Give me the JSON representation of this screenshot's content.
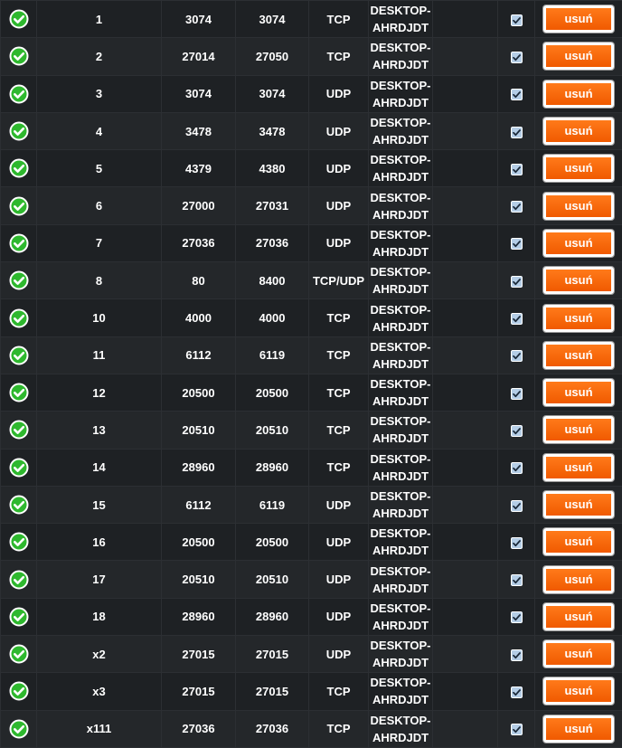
{
  "icons": {
    "status": "check-circle-icon",
    "enabled": "checkbox-checked-icon"
  },
  "colors": {
    "status_ok": "#2eb82e",
    "delete_button": "#f26a00",
    "checkbox": "#b4cde6"
  },
  "delete_label": "usuń",
  "rules": [
    {
      "id": "1",
      "ext_port": "3074",
      "int_port": "3074",
      "protocol": "TCP",
      "host_line1": "DESKTOP-",
      "host_line2": "AHRDJDT",
      "enabled": true
    },
    {
      "id": "2",
      "ext_port": "27014",
      "int_port": "27050",
      "protocol": "TCP",
      "host_line1": "DESKTOP-",
      "host_line2": "AHRDJDT",
      "enabled": true
    },
    {
      "id": "3",
      "ext_port": "3074",
      "int_port": "3074",
      "protocol": "UDP",
      "host_line1": "DESKTOP-",
      "host_line2": "AHRDJDT",
      "enabled": true
    },
    {
      "id": "4",
      "ext_port": "3478",
      "int_port": "3478",
      "protocol": "UDP",
      "host_line1": "DESKTOP-",
      "host_line2": "AHRDJDT",
      "enabled": true
    },
    {
      "id": "5",
      "ext_port": "4379",
      "int_port": "4380",
      "protocol": "UDP",
      "host_line1": "DESKTOP-",
      "host_line2": "AHRDJDT",
      "enabled": true
    },
    {
      "id": "6",
      "ext_port": "27000",
      "int_port": "27031",
      "protocol": "UDP",
      "host_line1": "DESKTOP-",
      "host_line2": "AHRDJDT",
      "enabled": true
    },
    {
      "id": "7",
      "ext_port": "27036",
      "int_port": "27036",
      "protocol": "UDP",
      "host_line1": "DESKTOP-",
      "host_line2": "AHRDJDT",
      "enabled": true
    },
    {
      "id": "8",
      "ext_port": "80",
      "int_port": "8400",
      "protocol": "TCP/UDP",
      "host_line1": "DESKTOP-",
      "host_line2": "AHRDJDT",
      "enabled": true
    },
    {
      "id": "10",
      "ext_port": "4000",
      "int_port": "4000",
      "protocol": "TCP",
      "host_line1": "DESKTOP-",
      "host_line2": "AHRDJDT",
      "enabled": true
    },
    {
      "id": "11",
      "ext_port": "6112",
      "int_port": "6119",
      "protocol": "TCP",
      "host_line1": "DESKTOP-",
      "host_line2": "AHRDJDT",
      "enabled": true
    },
    {
      "id": "12",
      "ext_port": "20500",
      "int_port": "20500",
      "protocol": "TCP",
      "host_line1": "DESKTOP-",
      "host_line2": "AHRDJDT",
      "enabled": true
    },
    {
      "id": "13",
      "ext_port": "20510",
      "int_port": "20510",
      "protocol": "TCP",
      "host_line1": "DESKTOP-",
      "host_line2": "AHRDJDT",
      "enabled": true
    },
    {
      "id": "14",
      "ext_port": "28960",
      "int_port": "28960",
      "protocol": "TCP",
      "host_line1": "DESKTOP-",
      "host_line2": "AHRDJDT",
      "enabled": true
    },
    {
      "id": "15",
      "ext_port": "6112",
      "int_port": "6119",
      "protocol": "UDP",
      "host_line1": "DESKTOP-",
      "host_line2": "AHRDJDT",
      "enabled": true
    },
    {
      "id": "16",
      "ext_port": "20500",
      "int_port": "20500",
      "protocol": "UDP",
      "host_line1": "DESKTOP-",
      "host_line2": "AHRDJDT",
      "enabled": true
    },
    {
      "id": "17",
      "ext_port": "20510",
      "int_port": "20510",
      "protocol": "UDP",
      "host_line1": "DESKTOP-",
      "host_line2": "AHRDJDT",
      "enabled": true
    },
    {
      "id": "18",
      "ext_port": "28960",
      "int_port": "28960",
      "protocol": "UDP",
      "host_line1": "DESKTOP-",
      "host_line2": "AHRDJDT",
      "enabled": true
    },
    {
      "id": "x2",
      "ext_port": "27015",
      "int_port": "27015",
      "protocol": "UDP",
      "host_line1": "DESKTOP-",
      "host_line2": "AHRDJDT",
      "enabled": true
    },
    {
      "id": "x3",
      "ext_port": "27015",
      "int_port": "27015",
      "protocol": "TCP",
      "host_line1": "DESKTOP-",
      "host_line2": "AHRDJDT",
      "enabled": true
    },
    {
      "id": "x111",
      "ext_port": "27036",
      "int_port": "27036",
      "protocol": "TCP",
      "host_line1": "DESKTOP-",
      "host_line2": "AHRDJDT",
      "enabled": true
    }
  ]
}
